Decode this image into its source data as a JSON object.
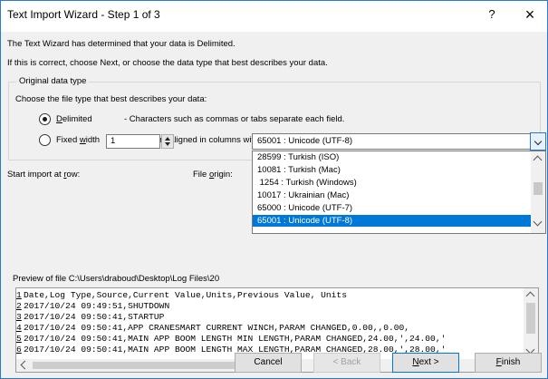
{
  "window": {
    "title": "Text Import Wizard - Step 1 of 3",
    "help": "?",
    "close": "×"
  },
  "intro": {
    "line1": "The Text Wizard has determined that your data is Delimited.",
    "line2": "If this is correct, choose Next, or choose the data type that best describes your data."
  },
  "data_type": {
    "legend": "Original data type",
    "prompt": "Choose the file type that best describes your data:",
    "options": [
      {
        "label_mnemonic": "D",
        "label_rest": "elimited",
        "desc": "- Characters such as commas or tabs separate each field.",
        "selected": true
      },
      {
        "label_pre": "Fixed ",
        "label_mnemonic": "w",
        "label_rest": "idth",
        "desc": "- Fields are aligned in columns with spaces between each field.",
        "selected": false
      }
    ]
  },
  "start_row": {
    "label_pre": "Start import at ",
    "label_mnemonic": "r",
    "label_rest": "ow:",
    "value": "1"
  },
  "file_origin": {
    "label_pre": "File ",
    "label_mnemonic": "o",
    "label_rest": "rigin:",
    "value": "65001 : Unicode (UTF-8)",
    "options": [
      "28599 : Turkish (ISO)",
      "10081 : Turkish (Mac)",
      " 1254 : Turkish (Windows)",
      "10017 : Ukrainian (Mac)",
      "65000 : Unicode (UTF-7)",
      "65001 : Unicode (UTF-8)"
    ],
    "selected_index": 5
  },
  "preview": {
    "label": "Preview of file C:\\Users\\draboud\\Desktop\\Log Files\\20",
    "rows": [
      {
        "n": "1",
        "text": "Date,Log Type,Source,Current Value,Units,Previous Value, Units"
      },
      {
        "n": "2",
        "text": "2017/10/24 09:49:51,SHUTDOWN"
      },
      {
        "n": "3",
        "text": "2017/10/24 09:50:41,STARTUP"
      },
      {
        "n": "4",
        "text": "2017/10/24 09:50:41,APP CRANESMART CURRENT WINCH,PARAM CHANGED,0.00,,0.00,"
      },
      {
        "n": "5",
        "text": "2017/10/24 09:50:41,MAIN APP BOOM LENGTH MIN LENGTH,PARAM CHANGED,24.00,',24.00,'"
      },
      {
        "n": "6",
        "text": "2017/10/24 09:50:41,MAIN APP BOOM LENGTH MAX LENGTH,PARAM CHANGED,28.00,',28.00,'"
      }
    ]
  },
  "buttons": {
    "cancel": "Cancel",
    "back": "< Back",
    "next_mnemonic": "N",
    "next_rest": "ext >",
    "finish_mnemonic": "F",
    "finish_rest": "inish"
  }
}
